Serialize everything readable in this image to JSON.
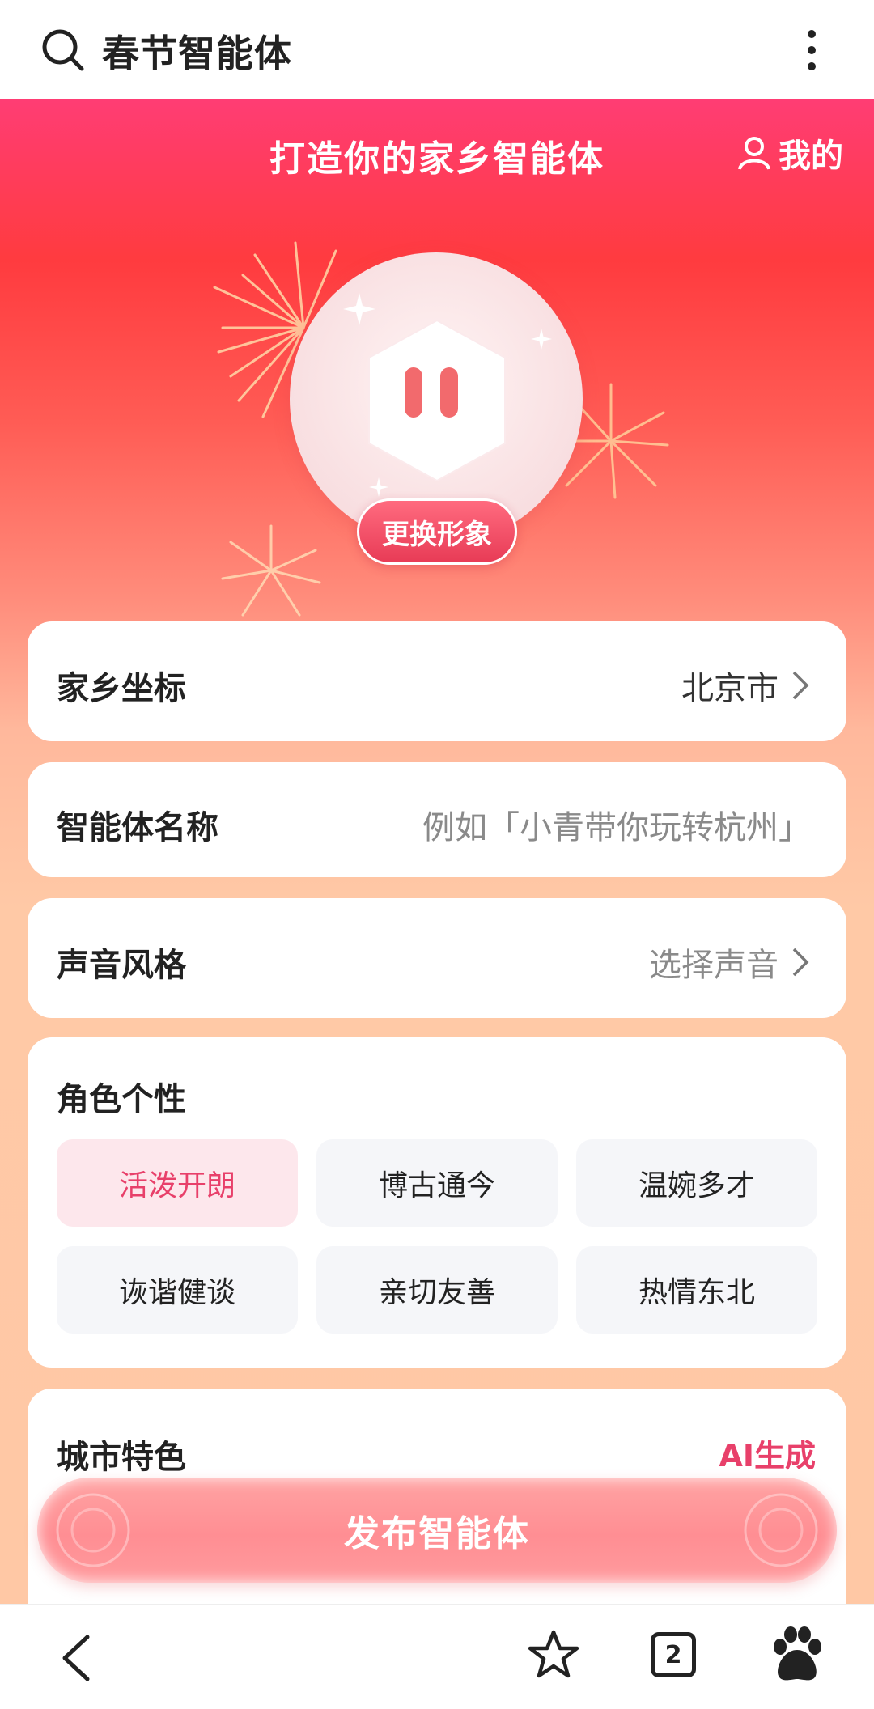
{
  "search": {
    "query": "春节智能体"
  },
  "header": {
    "title": "打造你的家乡智能体",
    "mine_label": "我的"
  },
  "avatar": {
    "change_label": "更换形象"
  },
  "hometown": {
    "label": "家乡坐标",
    "value": "北京市"
  },
  "agent_name": {
    "label": "智能体名称",
    "placeholder": "例如「小青带你玩转杭州」"
  },
  "voice": {
    "label": "声音风格",
    "value": "选择声音"
  },
  "traits": {
    "title": "角色个性",
    "items": [
      {
        "label": "活泼开朗",
        "selected": true
      },
      {
        "label": "博古通今",
        "selected": false
      },
      {
        "label": "温婉多才",
        "selected": false
      },
      {
        "label": "诙谐健谈",
        "selected": false
      },
      {
        "label": "亲切友善",
        "selected": false
      },
      {
        "label": "热情东北",
        "selected": false
      }
    ]
  },
  "city": {
    "title": "城市特色",
    "ai_label": "AI生成"
  },
  "publish": {
    "label": "发布智能体"
  },
  "bottom_nav": {
    "tab_count": "2"
  },
  "colors": {
    "accent": "#e8406a",
    "hero_top": "#ff3d74",
    "hero_bottom": "#ffc8a5"
  }
}
